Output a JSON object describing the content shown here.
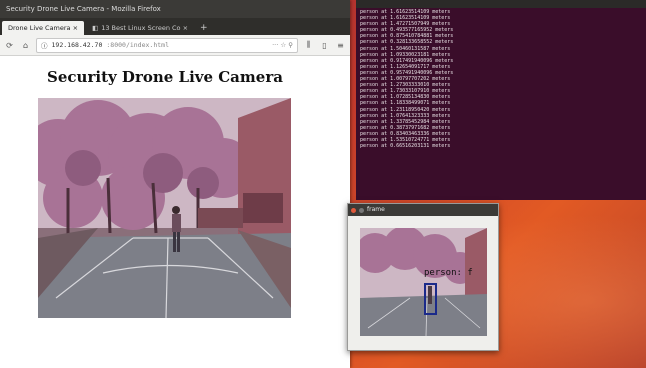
{
  "browser": {
    "window_title": "Security Drone Live Camera - Mozilla Firefox",
    "tabs": [
      {
        "label": "Drone Live Camera ×"
      },
      {
        "label": "13 Best Linux Screen Co ×"
      }
    ],
    "new_tab": "+",
    "url_host": "192.168.42.70",
    "url_rest": ":8000/index.html",
    "url_right": "··· ☆ ⚲",
    "page_title": "Security Drone Live Camera"
  },
  "terminal": {
    "lines": [
      "person at 1.61623514109 meters",
      "person at 1.61623514109 meters",
      "person at 1.47271507949 meters",
      "person at 0.493577165952 meters",
      "person at 0.875410784881 meters",
      "person at 0.328133658552 meters",
      "person at 1.50460131587 meters",
      "person at 1.09330023181 meters",
      "person at 0.917491940096 meters",
      "person at 1.12654091717 meters",
      "person at 0.957491940096 meters",
      "person at 1.00797707202 meters",
      "person at 1.27303333010 meters",
      "person at 1.73033107910 meters",
      "person at 1.07285134830 meters",
      "person at 1.18338499071 meters",
      "person at 1.23118950420 meters",
      "person at 1.07641323333 meters",
      "person at 1.33785452984 meters",
      "person at 0.38737971682 meters",
      "person at 0.83403463336 meters",
      "person at 1.53510724771 meters",
      "person at 0.66516203131 meters"
    ]
  },
  "frame_window": {
    "title": "frame",
    "detection_label": "person: f"
  },
  "colors": {
    "terminal_bg": "#3a0d2a",
    "detection_box": "#1b2a8a"
  }
}
